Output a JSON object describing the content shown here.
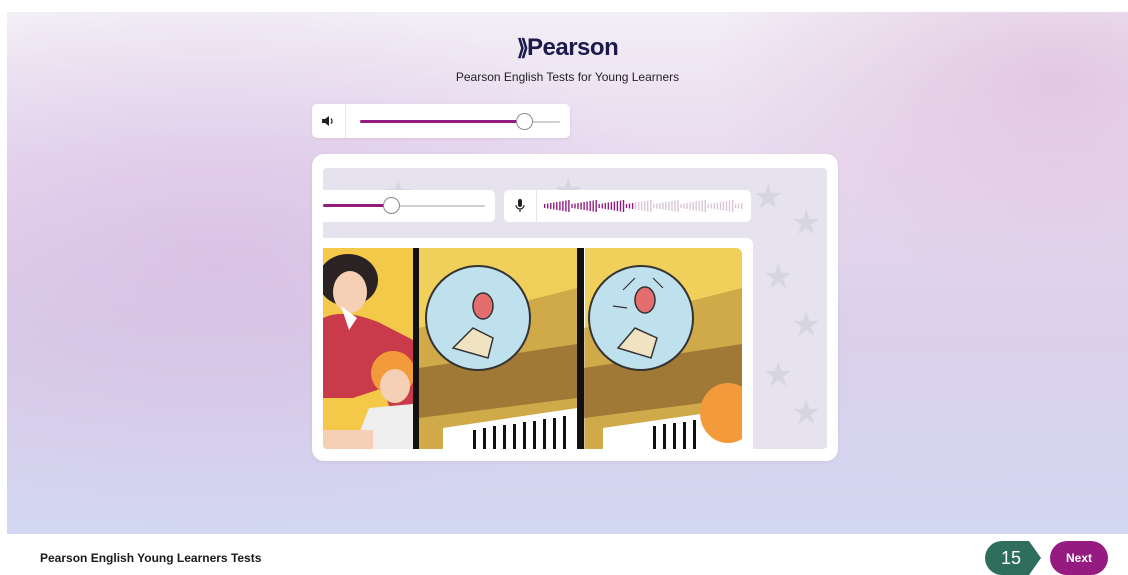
{
  "brand": {
    "logo_mark": "⟫",
    "logo_text": "Pearson",
    "subtitle": "Pearson English Tests for Young Learners"
  },
  "audio": {
    "speaker_icon": "speaker-icon",
    "volume_level": 0.82
  },
  "preview": {
    "volume_level": 0.42,
    "mic_icon": "microphone-icon",
    "level_fill": 0.46
  },
  "footer": {
    "title": "Pearson English Young Learners Tests",
    "step_number": "15",
    "next_label": "Next"
  },
  "colors": {
    "accent": "#951b81",
    "badge": "#2f6e5c",
    "logo": "#1c1a4b"
  }
}
